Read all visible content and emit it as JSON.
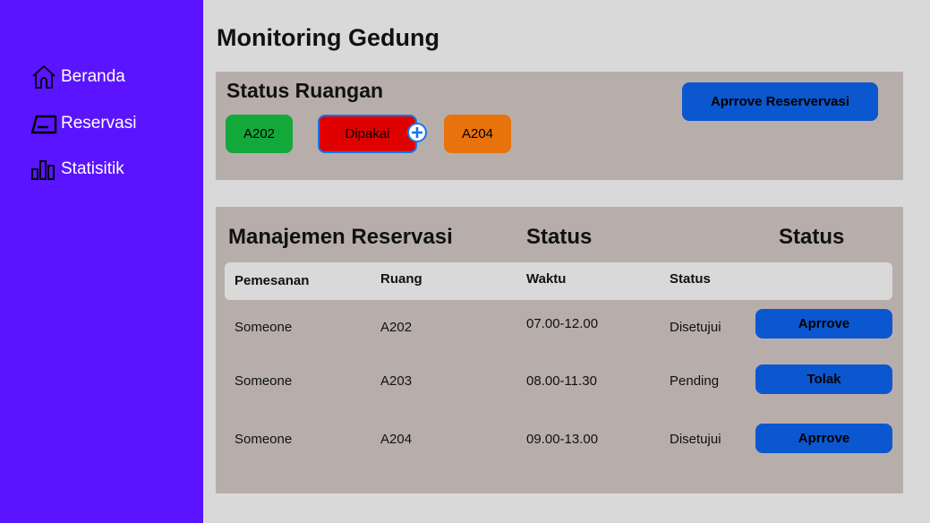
{
  "sidebar": {
    "items": [
      {
        "label": "Beranda",
        "icon": "home-icon"
      },
      {
        "label": "Reservasi",
        "icon": "reservation-icon"
      },
      {
        "label": "Statisitik",
        "icon": "chart-bars-icon"
      }
    ]
  },
  "page": {
    "title": "Monitoring Gedung"
  },
  "status_panel": {
    "title": "Status Ruangan",
    "approve_button": "Aprrove Reservervasi",
    "rooms": [
      {
        "label": "A202",
        "color": "#12a83a"
      },
      {
        "label": "Dipakai",
        "color": "#e00000"
      },
      {
        "label": "A204",
        "color": "#e8720c"
      }
    ]
  },
  "reservation_panel": {
    "title": "Manajemen Reservasi",
    "headings": [
      "Status",
      "Status"
    ],
    "columns": [
      "Pemesanan",
      "Ruang",
      "Waktu",
      "Status"
    ],
    "rows": [
      {
        "pemesan": "Someone",
        "ruang": "A202",
        "waktu": "07.00-12.00",
        "status": "Disetujui",
        "action": "Aprrove"
      },
      {
        "pemesan": "Someone",
        "ruang": "A203",
        "waktu": "08.00-11.30",
        "status": "Pending",
        "action": "Tolak"
      },
      {
        "pemesan": "Someone",
        "ruang": "A204",
        "waktu": "09.00-13.00",
        "status": "Disetujui",
        "action": "Aprrove"
      }
    ]
  },
  "colors": {
    "sidebar": "#5a14ff",
    "button": "#0b57d0",
    "panel": "#b7aeab"
  }
}
